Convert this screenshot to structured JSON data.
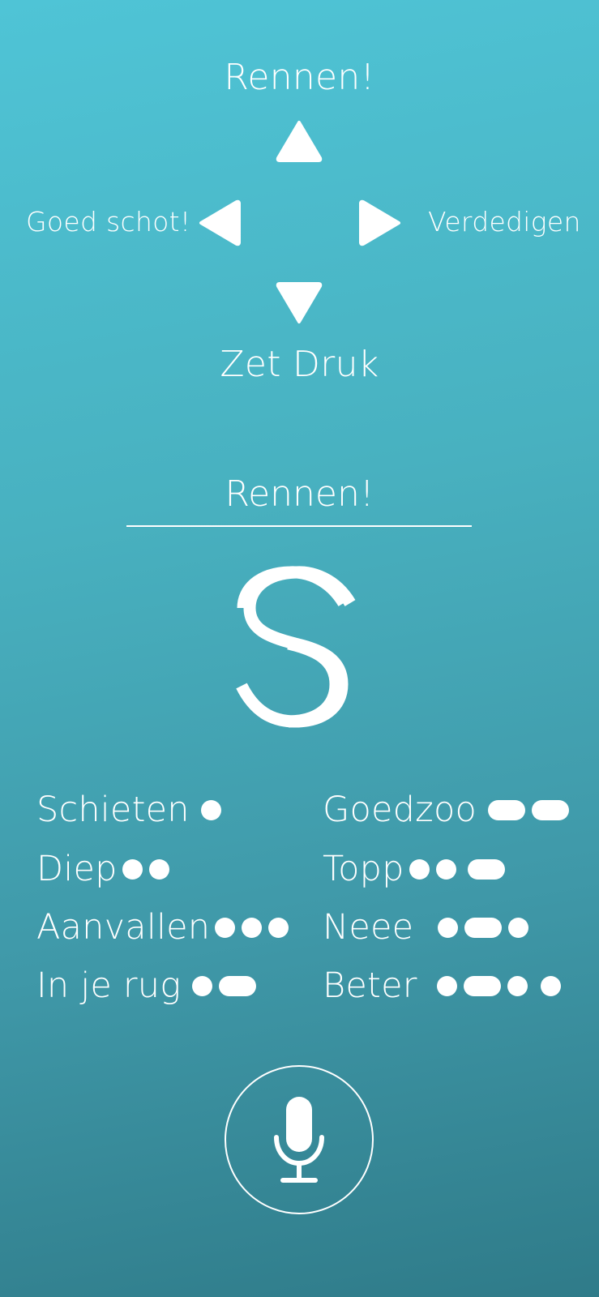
{
  "dpad": {
    "up": {
      "label": "Rennen!",
      "icon": "arrow-up-icon"
    },
    "left": {
      "label": "Goed schot!",
      "icon": "arrow-left-icon"
    },
    "right": {
      "label": "Verdedigen",
      "icon": "arrow-right-icon"
    },
    "down": {
      "label": "Zet Druk",
      "icon": "arrow-down-icon"
    }
  },
  "current_command": "Rennen!",
  "logo": {
    "icon": "double-s-logo-icon"
  },
  "legend": {
    "left": [
      {
        "label": "Schieten",
        "code": [
          "dot"
        ]
      },
      {
        "label": "Diep",
        "code": [
          "dot",
          "dot"
        ]
      },
      {
        "label": "Aanvallen",
        "code": [
          "dot",
          "dot",
          "dot"
        ]
      },
      {
        "label": "In je rug",
        "code": [
          "dot",
          "dash"
        ]
      }
    ],
    "right": [
      {
        "label": "Goedzoo",
        "code": [
          "dash",
          "dash"
        ]
      },
      {
        "label": "Topp",
        "code": [
          "dot",
          "dot",
          "dash"
        ]
      },
      {
        "label": "Neee",
        "code": [
          "dot",
          "dash",
          "dot"
        ]
      },
      {
        "label": "Beter",
        "code": [
          "dot",
          "dash",
          "dot",
          "dot"
        ]
      }
    ]
  },
  "mic": {
    "icon": "microphone-icon"
  },
  "colors": {
    "gradient_top": "#4fc4d6",
    "gradient_bottom": "#2f7b89",
    "foreground": "#ffffff"
  }
}
